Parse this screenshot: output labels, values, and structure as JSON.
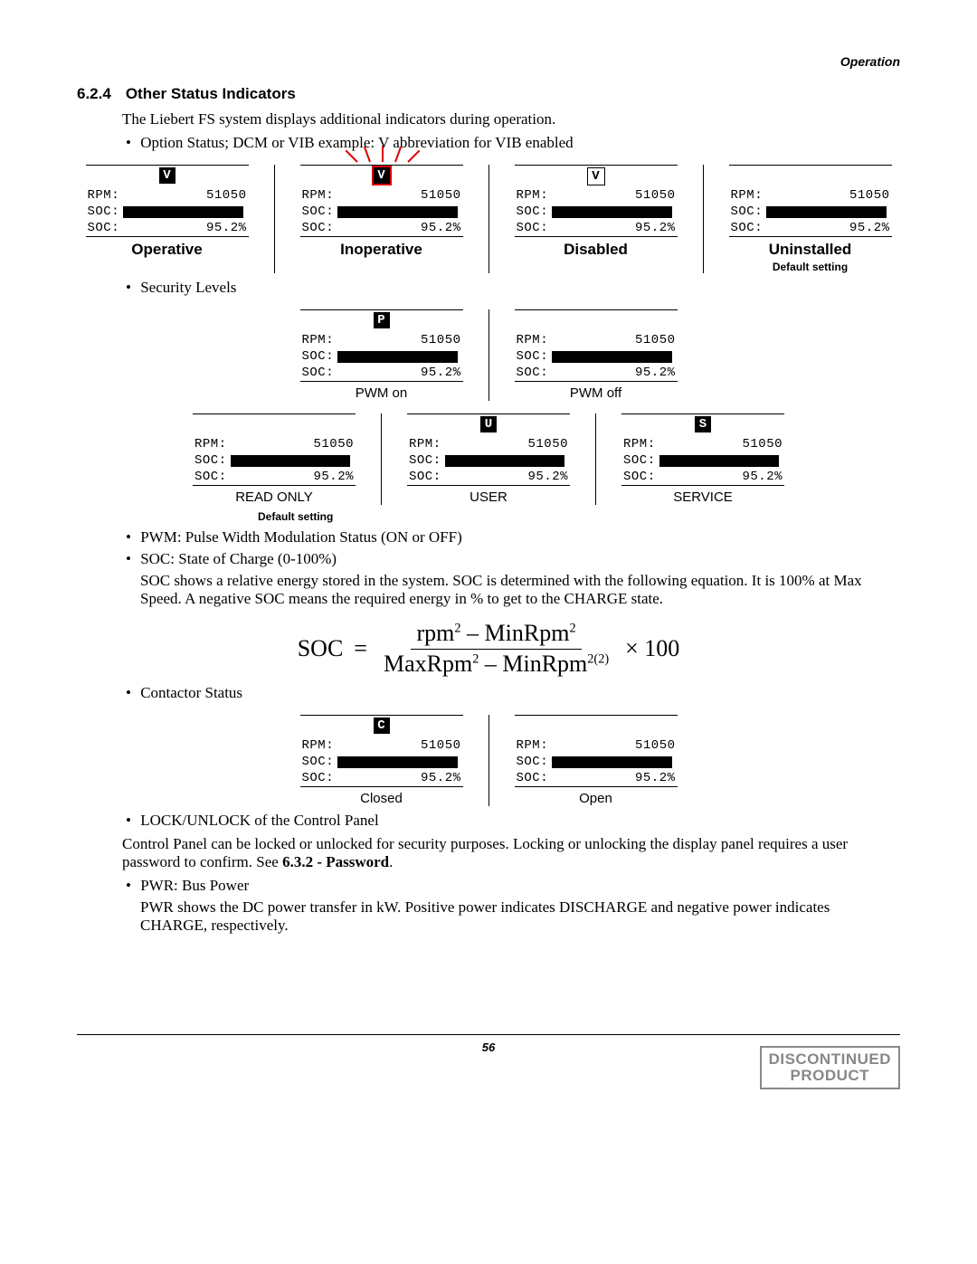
{
  "header": {
    "section": "Operation"
  },
  "heading": {
    "num": "6.2.4",
    "title": "Other Status Indicators"
  },
  "intro": "The Liebert FS system displays additional indicators during operation.",
  "bullets": {
    "option_status": "Option Status; DCM or VIB example: V abbreviation for VIB enabled",
    "security_levels": "Security Levels",
    "pwm": "PWM: Pulse Width Modulation Status (ON or OFF)",
    "soc_label": "SOC: State of Charge (0-100%)",
    "contactor": "Contactor Status",
    "lock": "LOCK/UNLOCK of the Control Panel",
    "pwr_label": "PWR: Bus Power"
  },
  "soc_text": "SOC shows a relative energy stored in the system. SOC is determined with the following equation. It is 100% at Max Speed. A negative SOC means the required energy in % to get to the CHARGE state.",
  "lock_text": "Control Panel can be locked or unlocked for security purposes. Locking or unlocking the display panel requires a user password to confirm. See ",
  "lock_ref": "6.3.2 - Password",
  "pwr_text": "PWR shows the DC power transfer in kW. Positive power indicates DISCHARGE and negative power indicates CHARGE, respectively.",
  "lcd_common": {
    "rpm_label": "RPM:",
    "soc_label": "SOC:",
    "rpm_value": "51050",
    "soc_value": "95.2%"
  },
  "option_row": [
    {
      "badge": "V",
      "badge_style": "solid",
      "caption": "Operative"
    },
    {
      "badge": "V",
      "badge_style": "solid-flash",
      "caption": "Inoperative"
    },
    {
      "badge": "V",
      "badge_style": "outline",
      "caption": "Disabled"
    },
    {
      "badge": "",
      "badge_style": "none",
      "caption": "Uninstalled",
      "sub": "Default setting"
    }
  ],
  "security_top": [
    {
      "badge": "P",
      "caption": "PWM on"
    },
    {
      "badge": "",
      "caption": "PWM off"
    }
  ],
  "security_bottom": [
    {
      "badge": "",
      "caption": "READ ONLY"
    },
    {
      "badge": "U",
      "caption": "USER"
    },
    {
      "badge": "S",
      "caption": "SERVICE"
    }
  ],
  "default_setting": "Default setting",
  "contactor_row": [
    {
      "badge": "C",
      "caption": "Closed"
    },
    {
      "badge": "",
      "caption": "Open"
    }
  ],
  "formula": {
    "lhs": "SOC",
    "eq": "=",
    "num": "rpm² – MinRpm²",
    "den": "MaxRpm² – MinRpm",
    "den_exp": "2(2)",
    "tail": "× 100"
  },
  "footer": {
    "page": "56",
    "stamp1": "DISCONTINUED",
    "stamp2": "PRODUCT"
  }
}
